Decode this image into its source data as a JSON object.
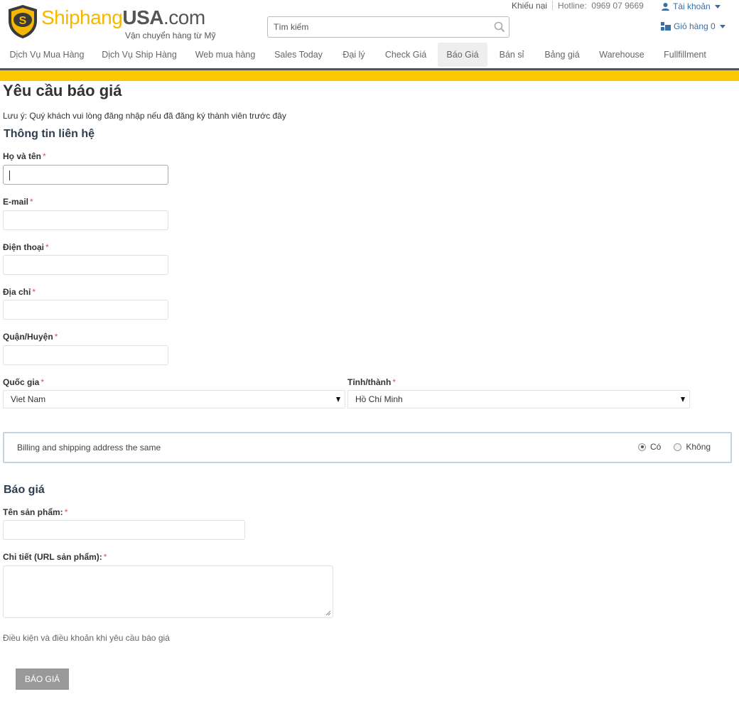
{
  "header": {
    "logo": {
      "ship": "Shiphang",
      "usa": "USA",
      "com": ".com",
      "tagline": "Vận chuyển hàng từ Mỹ"
    },
    "search_placeholder": "Tìm kiếm",
    "complain": "Khiếu nại",
    "hotline_label": "Hotline:",
    "hotline_number": "0969 07 9669",
    "account": "Tài khoản",
    "cart": "Giỏ hàng 0"
  },
  "nav": [
    {
      "label": "Dịch Vụ Mua Hàng",
      "active": false
    },
    {
      "label": "Dịch Vụ Ship Hàng",
      "active": false
    },
    {
      "label": "Web mua hàng",
      "active": false
    },
    {
      "label": "Sales Today",
      "active": false
    },
    {
      "label": "Đại lý",
      "active": false
    },
    {
      "label": "Check Giá",
      "active": false
    },
    {
      "label": "Báo Giá",
      "active": true
    },
    {
      "label": "Bán sỉ",
      "active": false
    },
    {
      "label": "Bảng giá",
      "active": false
    },
    {
      "label": "Warehouse",
      "active": false
    },
    {
      "label": "Fullfillment",
      "active": false
    }
  ],
  "page": {
    "title": "Yêu cầu báo giá",
    "note": "Lưu ý: Quý khách vui lòng đăng nhập nếu đã đăng ký thành viên trước đây"
  },
  "contact": {
    "title": "Thông tin liên hệ",
    "fields": {
      "name": {
        "label": "Họ và tên",
        "value": ""
      },
      "email": {
        "label": "E-mail",
        "value": ""
      },
      "phone": {
        "label": "Điện thoại",
        "value": ""
      },
      "address": {
        "label": "Địa chỉ",
        "value": ""
      },
      "district": {
        "label": "Quận/Huyện",
        "value": ""
      }
    },
    "country": {
      "label": "Quốc gia",
      "value": "Viet Nam"
    },
    "province": {
      "label": "Tỉnh/thành",
      "value": "Hồ Chí Minh"
    },
    "required_mark": "*"
  },
  "billing": {
    "text": "Billing and shipping address the same",
    "options": [
      {
        "label": "Có",
        "checked": true
      },
      {
        "label": "Không",
        "checked": false
      }
    ]
  },
  "quote": {
    "title": "Báo giá",
    "product_label": "Tên sản phẩm:",
    "detail_label": "Chi tiết (URL sản phẩm):",
    "terms": "Điều kiện và điều khoản khi yêu cầu báo giá",
    "submit": "BÁO GIÁ"
  },
  "colors": {
    "brand_yellow": "#fcc800",
    "link_blue": "#3a6ea5",
    "required_red": "#d9534f",
    "heading": "#2d3e50"
  }
}
